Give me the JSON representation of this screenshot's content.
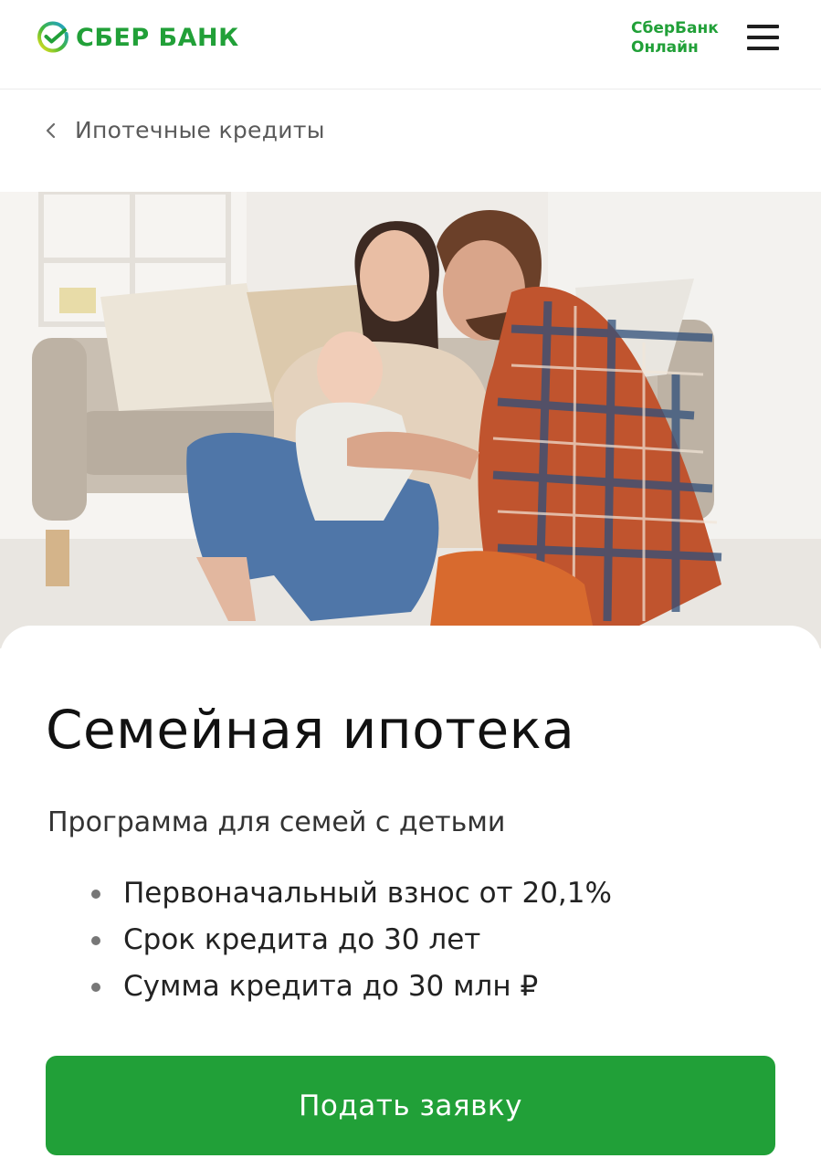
{
  "header": {
    "logo_text": "СБЕР БАНК",
    "online_link": {
      "line1": "СберБанк",
      "line2": "Онлайн"
    },
    "menu_icon": "hamburger-menu-icon"
  },
  "breadcrumb": {
    "icon": "chevron-left-icon",
    "label": "Ипотечные кредиты"
  },
  "hero": {
    "image": "family-on-floor-photo"
  },
  "product": {
    "title": "Семейная ипотека",
    "subtitle": "Программа для семей с детьми",
    "features": [
      "Первоначальный взнос от 20,1%",
      "Срок кредита до 30 лет",
      "Сумма кредита до 30 млн ₽"
    ],
    "cta_label": "Подать заявку"
  },
  "colors": {
    "brand_green": "#21a038",
    "text": "#111111",
    "muted": "#5a5a5a"
  }
}
